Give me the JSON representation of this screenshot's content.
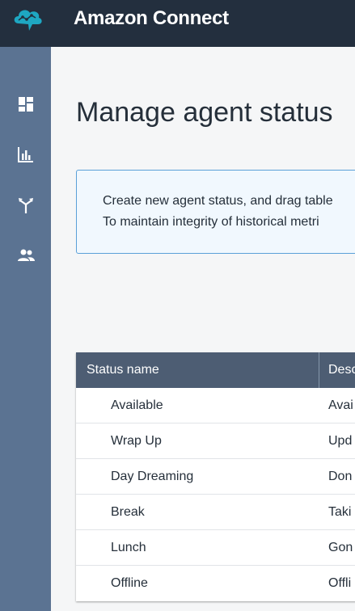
{
  "header": {
    "app_title": "Amazon Connect",
    "logo_icon": "amazon-connect-cloud-icon",
    "background": "#232f3e"
  },
  "sidebar": {
    "background": "#5b7392",
    "items": [
      {
        "icon": "dashboard-icon"
      },
      {
        "icon": "metrics-bar-chart-icon"
      },
      {
        "icon": "routing-icon"
      },
      {
        "icon": "users-icon"
      }
    ]
  },
  "main": {
    "page_title": "Manage agent status",
    "info": {
      "line1": "Create new agent status, and drag table",
      "line2": "To maintain integrity of historical metri"
    },
    "table": {
      "columns": [
        "Status name",
        "Desc"
      ],
      "rows": [
        {
          "name": "Available",
          "desc": "Avai"
        },
        {
          "name": "Wrap Up",
          "desc": "Upd"
        },
        {
          "name": "Day Dreaming",
          "desc": "Don"
        },
        {
          "name": "Break",
          "desc": "Taki"
        },
        {
          "name": "Lunch",
          "desc": "Gon"
        },
        {
          "name": "Offline",
          "desc": "Offli"
        }
      ]
    }
  }
}
